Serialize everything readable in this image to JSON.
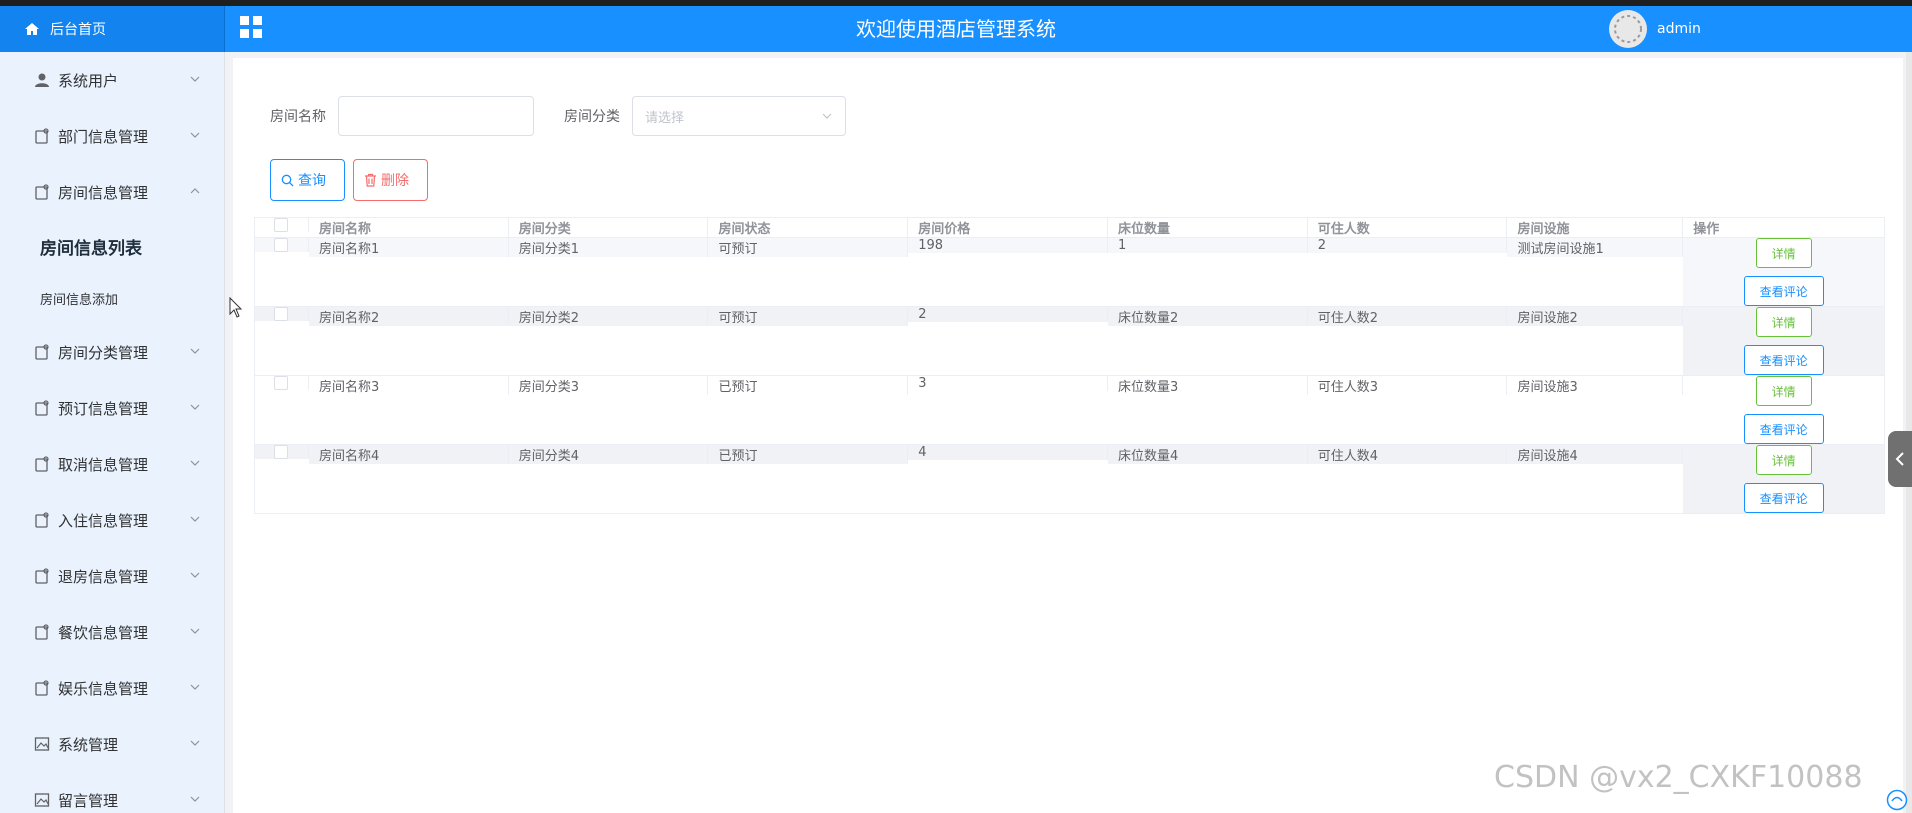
{
  "header": {
    "home_label": "后台首页",
    "title": "欢迎使用酒店管理系统",
    "username": "admin"
  },
  "sidebar": {
    "items": [
      {
        "label": "系统用户",
        "icon": "user-icon"
      },
      {
        "label": "部门信息管理",
        "icon": "tag-icon"
      },
      {
        "label": "房间信息管理",
        "icon": "tag-icon"
      },
      {
        "label": "房间分类管理",
        "icon": "tag-icon"
      },
      {
        "label": "预订信息管理",
        "icon": "tag-icon"
      },
      {
        "label": "取消信息管理",
        "icon": "tag-icon"
      },
      {
        "label": "入住信息管理",
        "icon": "tag-icon"
      },
      {
        "label": "退房信息管理",
        "icon": "tag-icon"
      },
      {
        "label": "餐饮信息管理",
        "icon": "tag-icon"
      },
      {
        "label": "娱乐信息管理",
        "icon": "tag-icon"
      },
      {
        "label": "系统管理",
        "icon": "image-icon"
      },
      {
        "label": "留言管理",
        "icon": "image-icon"
      }
    ],
    "sub_items": [
      {
        "label": "房间信息列表"
      },
      {
        "label": "房间信息添加"
      }
    ]
  },
  "search": {
    "room_name_label": "房间名称",
    "room_name_value": "",
    "category_label": "房间分类",
    "category_placeholder": "请选择",
    "query_label": "查询",
    "delete_label": "删除"
  },
  "table": {
    "columns": [
      "房间名称",
      "房间分类",
      "房间状态",
      "房间价格",
      "床位数量",
      "可住人数",
      "房间设施",
      "操作"
    ],
    "rows": [
      {
        "name": "房间名称1",
        "category": "房间分类1",
        "status": "可预订",
        "price": "198",
        "beds": "1",
        "capacity": "2",
        "facility": "测试房间设施1"
      },
      {
        "name": "房间名称2",
        "category": "房间分类2",
        "status": "可预订",
        "price": "2",
        "beds": "床位数量2",
        "capacity": "可住人数2",
        "facility": "房间设施2"
      },
      {
        "name": "房间名称3",
        "category": "房间分类3",
        "status": "已预订",
        "price": "3",
        "beds": "床位数量3",
        "capacity": "可住人数3",
        "facility": "房间设施3"
      },
      {
        "name": "房间名称4",
        "category": "房间分类4",
        "status": "已预订",
        "price": "4",
        "beds": "床位数量4",
        "capacity": "可住人数4",
        "facility": "房间设施4"
      }
    ],
    "detail_label": "详情",
    "comment_label": "查看评论"
  },
  "watermark": "CSDN @vx2_CXKF10088",
  "colors": {
    "header_bg": "#1890ff",
    "sidebar_bg": "#eaf3fd",
    "detail_green": "#67c23a",
    "primary_blue": "#1890ff",
    "danger_red": "#f56c6c"
  }
}
